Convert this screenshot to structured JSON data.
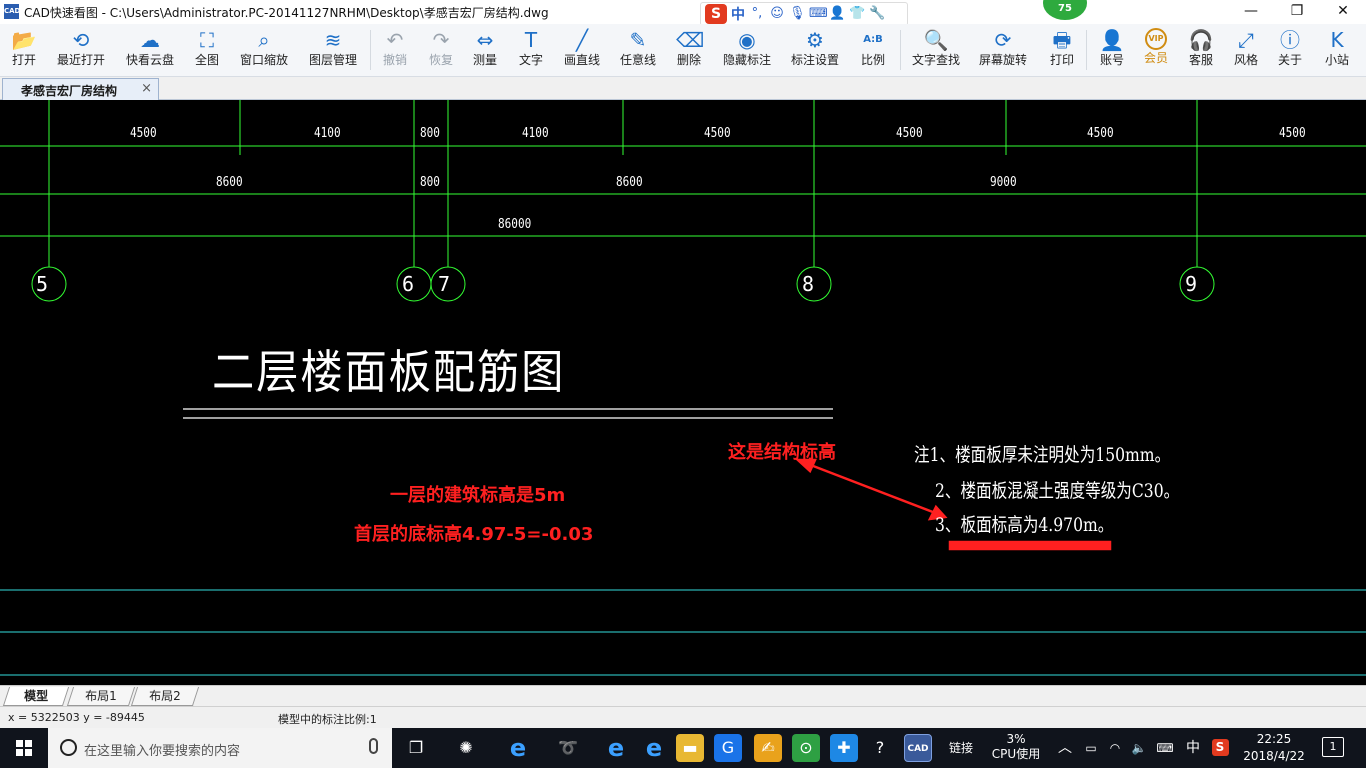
{
  "window": {
    "app_icon_text": "CAD",
    "title": "CAD快速看图 - C:\\Users\\Administrator.PC-20141127NRHM\\Desktop\\孝感吉宏厂房结构.dwg",
    "level_badge": "75",
    "ime": {
      "lang": "中",
      "punct": "°,"
    },
    "controls": {
      "minimize": "—",
      "restore": "❐",
      "close": "✕"
    }
  },
  "toolbar": [
    {
      "id": "open",
      "label": "打开",
      "icon": "folder-icon",
      "glyph": "📂"
    },
    {
      "id": "recent",
      "label": "最近打开",
      "icon": "history-icon",
      "glyph": "⟲"
    },
    {
      "id": "cloud",
      "label": "快看云盘",
      "icon": "cloud-icon",
      "glyph": "☁"
    },
    {
      "id": "fullview",
      "label": "全图",
      "icon": "fullscreen-icon",
      "glyph": "⛶"
    },
    {
      "id": "zoomwin",
      "label": "窗口缩放",
      "icon": "zoom-window-icon",
      "glyph": "⌕"
    },
    {
      "id": "layers",
      "label": "图层管理",
      "icon": "layers-icon",
      "glyph": "≋"
    },
    {
      "id": "undo",
      "label": "撤销",
      "icon": "undo-icon",
      "glyph": "↶",
      "disabled": true
    },
    {
      "id": "redo",
      "label": "恢复",
      "icon": "redo-icon",
      "glyph": "↷",
      "disabled": true
    },
    {
      "id": "measure",
      "label": "测量",
      "icon": "ruler-icon",
      "glyph": "⇔"
    },
    {
      "id": "text",
      "label": "文字",
      "icon": "text-icon",
      "glyph": "T"
    },
    {
      "id": "line",
      "label": "画直线",
      "icon": "line-icon",
      "glyph": "╱"
    },
    {
      "id": "freeline",
      "label": "任意线",
      "icon": "pen-icon",
      "glyph": "✎"
    },
    {
      "id": "delete",
      "label": "删除",
      "icon": "eraser-icon",
      "glyph": "⌫"
    },
    {
      "id": "hide",
      "label": "隐藏标注",
      "icon": "eye-hide-icon",
      "glyph": "◉"
    },
    {
      "id": "markset",
      "label": "标注设置",
      "icon": "settings-icon",
      "glyph": "⚙"
    },
    {
      "id": "scale",
      "label": "比例",
      "icon": "scale-icon",
      "glyph": "A:B"
    },
    {
      "id": "findtext",
      "label": "文字查找",
      "icon": "text-search-icon",
      "glyph": "🔍"
    },
    {
      "id": "rotate",
      "label": "屏幕旋转",
      "icon": "rotate-icon",
      "glyph": "⟳"
    },
    {
      "id": "print",
      "label": "打印",
      "icon": "printer-icon",
      "glyph": "🖶"
    },
    {
      "id": "account",
      "label": "账号",
      "icon": "user-icon",
      "glyph": "👤"
    },
    {
      "id": "vip",
      "label": "会员",
      "icon": "vip-icon",
      "glyph": "VIP"
    },
    {
      "id": "service",
      "label": "客服",
      "icon": "headset-icon",
      "glyph": "🎧"
    },
    {
      "id": "style",
      "label": "风格",
      "icon": "style-icon",
      "glyph": "⤢"
    },
    {
      "id": "about",
      "label": "关于",
      "icon": "info-icon",
      "glyph": "ⓘ"
    },
    {
      "id": "site",
      "label": "小站",
      "icon": "site-icon",
      "glyph": "K"
    }
  ],
  "document_tab": {
    "label": "孝感吉宏厂房结构",
    "close": "×"
  },
  "drawing": {
    "dims_row1": [
      "4500",
      "4100",
      "800",
      "4100",
      "4500",
      "4500",
      "4500",
      "4500"
    ],
    "dims_row2": [
      "8600",
      "800",
      "8600",
      "9000"
    ],
    "dim_total": "86000",
    "axes": [
      "5",
      "6",
      "7",
      "8",
      "9"
    ],
    "title": "二层楼面板配筋图",
    "notes": [
      "注1、楼面板厚未注明处为150mm。",
      "2、楼面板混凝土强度等级为C30。",
      "3、板面标高为4.970m。"
    ],
    "annotations": {
      "structural_elevation": "这是结构标高",
      "first_floor_elevation": "一层的建筑标高是5m",
      "bottom_elevation": "首层的底标高4.97-5=-0.03"
    },
    "colors": {
      "background": "#000000",
      "grid": "#33ff33",
      "boundary": "#33dddd",
      "annotation": "#ff2020",
      "text": "#ffffff"
    }
  },
  "layout_tabs": [
    "模型",
    "布局1",
    "布局2"
  ],
  "status": {
    "coords": "x = 5322503  y = -89445",
    "scale_text": "模型中的标注比例:1"
  },
  "taskbar": {
    "search_placeholder": "在这里输入你要搜索的内容",
    "network_label": "链接",
    "cpu_percent": "3%",
    "cpu_label": "CPU使用",
    "ime_lang": "中",
    "time": "22:25",
    "date": "2018/4/22",
    "notifications": "1",
    "pinned": [
      {
        "name": "task-view-icon",
        "glyph": "❐",
        "bg": "transparent"
      },
      {
        "name": "pinwheel-app-icon",
        "glyph": "✺",
        "bg": "transparent"
      },
      {
        "name": "ie-classic-icon",
        "glyph": "e",
        "bg": "transparent"
      },
      {
        "name": "spiral-app-icon",
        "glyph": "➰",
        "bg": "transparent"
      },
      {
        "name": "edge-icon",
        "glyph": "e",
        "bg": "transparent"
      },
      {
        "name": "ie-icon",
        "glyph": "e",
        "bg": "transparent"
      },
      {
        "name": "file-explorer-icon",
        "glyph": "▬",
        "bg": "#e8b833"
      },
      {
        "name": "g-app-icon",
        "glyph": "G",
        "bg": "#1a73e8"
      },
      {
        "name": "notes-app-icon",
        "glyph": "✍",
        "bg": "#e9a21c"
      },
      {
        "name": "green-app-icon",
        "glyph": "⊙",
        "bg": "#2ea043"
      },
      {
        "name": "plus-app-icon",
        "glyph": "✚",
        "bg": "#1e88e5"
      },
      {
        "name": "help-app-icon",
        "glyph": "?",
        "bg": "transparent"
      },
      {
        "name": "cad-app-icon",
        "glyph": "CAD",
        "bg": "#3a5a9a"
      }
    ]
  }
}
